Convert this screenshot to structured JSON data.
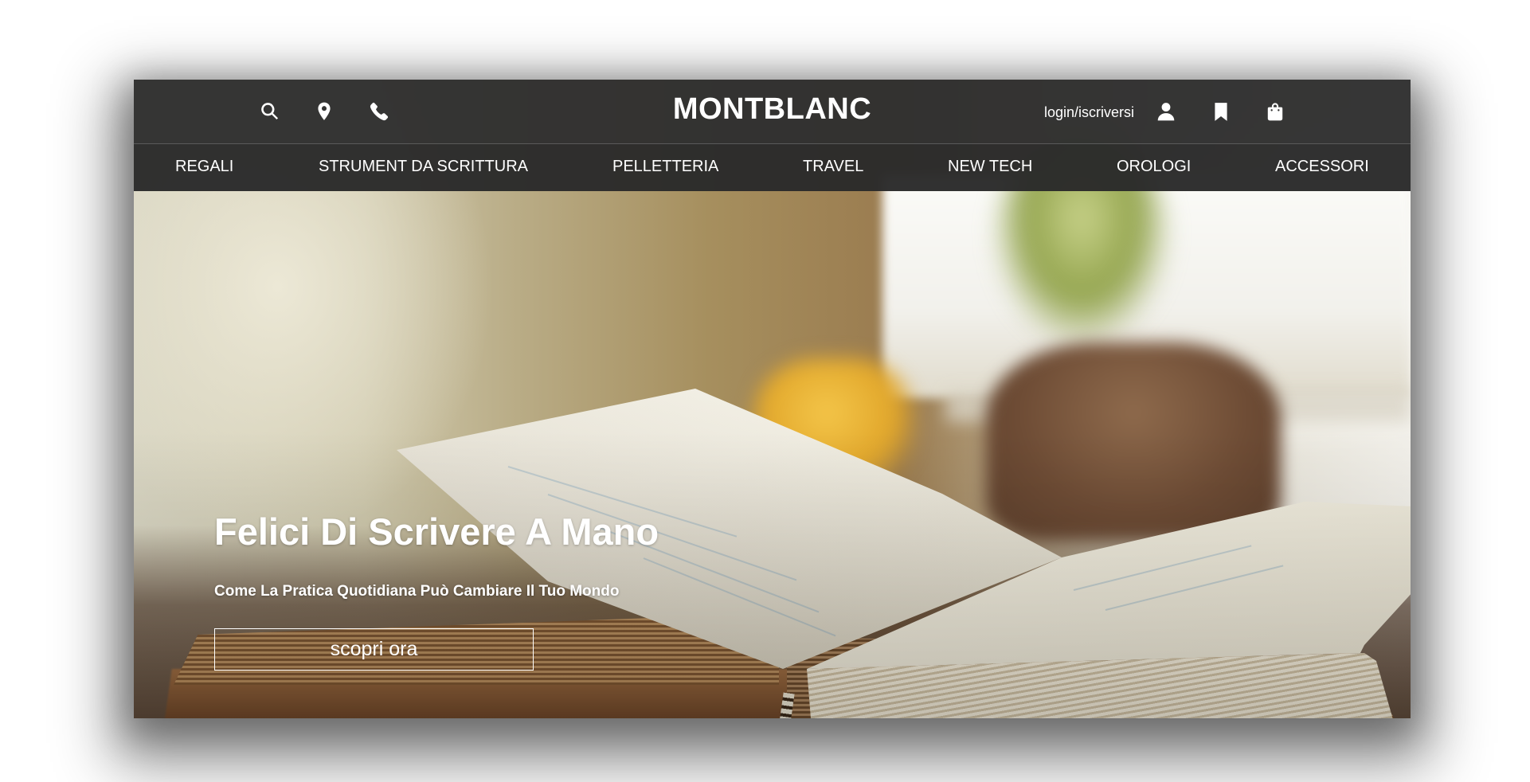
{
  "header": {
    "brand": "MONTBLANC",
    "login_label": "login/iscriversi",
    "left_icons": [
      "search-icon",
      "location-pin-icon",
      "phone-icon"
    ],
    "right_icons": [
      "user-icon",
      "bookmark-icon",
      "shopping-bag-icon"
    ],
    "bar_color": "#303030"
  },
  "nav": {
    "items": [
      "REGALI",
      "STRUMENT DA SCRITTURA",
      "PELLETTERIA",
      "TRAVEL",
      "NEW TECH",
      "OROLOGI",
      "ACCESSORI"
    ]
  },
  "hero": {
    "title": "Felici Di Scrivere A Mano",
    "subtitle": "Come La Pratica Quotidiana Può Cambiare Il Tuo Mondo",
    "cta_label": "scopri ora",
    "image_subject": "open handwritten notebook on a wooden table"
  }
}
